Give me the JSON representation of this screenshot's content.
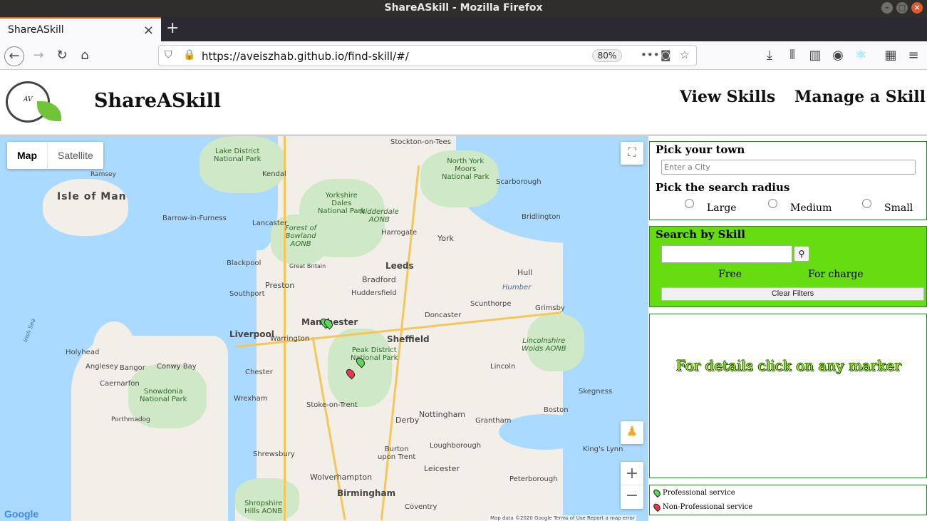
{
  "window": {
    "title": "ShareASkill - Mozilla Firefox"
  },
  "browser": {
    "tab_title": "ShareASkill",
    "url": "https://aveiszhab.github.io/find-skill/#/",
    "zoom": "80%"
  },
  "header": {
    "logo_text": "AV",
    "app_title": "ShareASkill",
    "nav": {
      "view_skills": "View Skills",
      "manage_skill": "Manage a Skill"
    }
  },
  "map": {
    "type_map": "Map",
    "type_satellite": "Satellite",
    "google": "Google",
    "footer": "Map data ©2020 Google   Terms of Use   Report a map error",
    "labels": {
      "isle_of_man": "Isle of Man",
      "lake_district": "Lake District\nNational Park",
      "kendal": "Kendal",
      "stockton": "Stockton-on-Tees",
      "ny_moors": "North York\nMoors\nNational Park",
      "scarborough": "Scarborough",
      "yorkshire_dales": "Yorkshire\nDales\nNational Park",
      "nidderdale": "Nidderdale\nAONB",
      "harrogate": "Harrogate",
      "york": "York",
      "bridlington": "Bridlington",
      "barrow": "Barrow-in-Furness",
      "lancaster": "Lancaster",
      "bowland": "Forest of\nBowland\nAONB",
      "blackpool": "Blackpool",
      "great_britain": "Great Britain",
      "leeds": "Leeds",
      "hull": "Hull",
      "bradford": "Bradford",
      "southport": "Southport",
      "preston": "Preston",
      "huddersfield": "Huddersfield",
      "humber": "Humber",
      "grimsby": "Grimsby",
      "scunthorpe": "Scunthorpe",
      "doncaster": "Doncaster",
      "manchester": "Manchester",
      "liverpool": "Liverpool",
      "warrington": "Warrington",
      "sheffield": "Sheffield",
      "lincolnshire": "Lincolnshire\nWolds AONB",
      "holyhead": "Holyhead",
      "anglesey": "Anglesey",
      "peak_district": "Peak District\nNational Park",
      "chester": "Chester",
      "lincoln": "Lincoln",
      "bangor": "Bangor",
      "conwy": "Conwy Bay",
      "caernarfon": "Caernarfon",
      "snowdonia": "Snowdonia\nNational Park",
      "wrexham": "Wrexham",
      "skegness": "Skegness",
      "stoke": "Stoke-on-Trent",
      "nottingham": "Nottingham",
      "derby": "Derby",
      "boston": "Boston",
      "grantham": "Grantham",
      "porthmadog": "Porthmadog",
      "shrewsbury": "Shrewsbury",
      "burton": "Burton\nupon Trent",
      "loughborough": "Loughborough",
      "kings_lynn": "King's Lynn",
      "leicester": "Leicester",
      "peterborough": "Peterborough",
      "wolverhampton": "Wolverhampton",
      "birmingham": "Birmingham",
      "shropshire": "Shropshire\nHills AONB",
      "coventry": "Coventry",
      "irish_sea": "Irish Sea",
      "ramsey": "Ramsey"
    }
  },
  "panel": {
    "town_heading": "Pick your town",
    "city_placeholder": "Enter a City",
    "radius_heading": "Pick the search radius",
    "radius_options": [
      "Large",
      "Medium",
      "Small"
    ],
    "skill_heading": "Search by Skill",
    "free": "Free",
    "for_charge": "For charge",
    "clear_filters": "Clear Filters",
    "details": "For details click on any marker",
    "legend": {
      "professional": "Professional service",
      "non_professional": "Non-Professional service"
    }
  },
  "colors": {
    "accent_green": "#66dd11",
    "panel_border": "#2e7d32",
    "marker_professional": "#5fd35f",
    "marker_non_professional": "#e8394a"
  }
}
